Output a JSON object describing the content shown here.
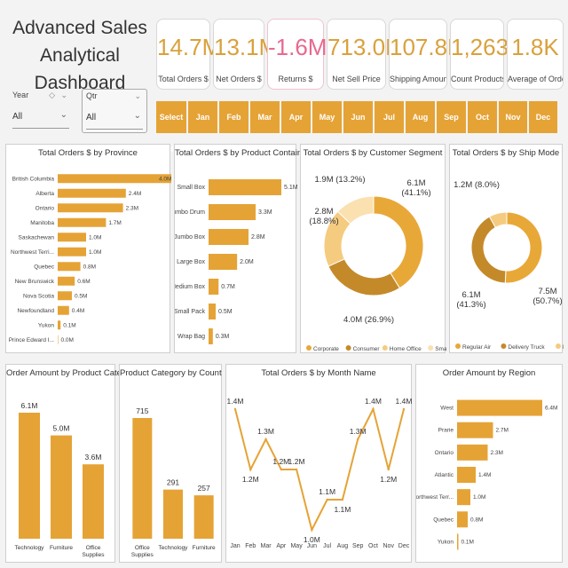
{
  "title_line1": "Advanced Sales",
  "title_line2": "Analytical Dashboard",
  "kpis": [
    {
      "value": "14.7M",
      "label": "Total Orders $"
    },
    {
      "value": "13.1M",
      "label": "Net Orders $"
    },
    {
      "value": "-1.6M",
      "label": "Returns $"
    },
    {
      "value": "713.0K",
      "label": "Net Sell Price"
    },
    {
      "value": "107.8K",
      "label": "Shipping Amount"
    },
    {
      "value": "1,263",
      "label": "Count Products"
    },
    {
      "value": "1.8K",
      "label": "Average of Order ..."
    }
  ],
  "slicers": {
    "year": {
      "title": "Year",
      "value": "All"
    },
    "qtr": {
      "title": "Qtr",
      "value": "All"
    }
  },
  "months": [
    "Select all",
    "Jan",
    "Feb",
    "Mar",
    "Apr",
    "May",
    "Jun",
    "Jul",
    "Aug",
    "Sep",
    "Oct",
    "Nov",
    "Dec"
  ],
  "colors": {
    "accent": "#e5a336",
    "negative": "#e8698f"
  },
  "chart_data": [
    {
      "id": "province",
      "type": "bar",
      "orientation": "horizontal",
      "title": "Total Orders $ by Province",
      "categories": [
        "British Columbia",
        "Alberta",
        "Ontario",
        "Manitoba",
        "Saskachewan",
        "Northwest Terri...",
        "Quebec",
        "New Brunswick",
        "Nova Scotia",
        "Newfoundland",
        "Yukon",
        "Prince Edward I..."
      ],
      "values": [
        4.0,
        2.4,
        2.3,
        1.7,
        1.0,
        1.0,
        0.8,
        0.6,
        0.5,
        0.4,
        0.1,
        0.0
      ],
      "labels": [
        "4.0M",
        "2.4M",
        "2.3M",
        "1.7M",
        "1.0M",
        "1.0M",
        "0.8M",
        "0.6M",
        "0.5M",
        "0.4M",
        "0.1M",
        "0.0M"
      ]
    },
    {
      "id": "container",
      "type": "bar",
      "orientation": "horizontal",
      "title": "Total Orders $ by Product Container",
      "categories": [
        "Small Box",
        "Jumbo Drum",
        "Jumbo Box",
        "Large Box",
        "Medium Box",
        "Small Pack",
        "Wrap Bag"
      ],
      "values": [
        5.1,
        3.3,
        2.8,
        2.0,
        0.7,
        0.5,
        0.3
      ],
      "labels": [
        "5.1M",
        "3.3M",
        "2.8M",
        "2.0M",
        "0.7M",
        "0.5M",
        "0.3M"
      ]
    },
    {
      "id": "segment",
      "type": "pie",
      "donut": true,
      "title": "Total Orders $ by Customer Segment",
      "categories": [
        "Corporate",
        "Consumer",
        "Home Office",
        "Small Business"
      ],
      "values": [
        6.1,
        4.0,
        2.8,
        1.9
      ],
      "labels": [
        "6.1M\n(41.1%)",
        "4.0M (26.9%)",
        "2.8M\n(18.8%)",
        "1.9M (13.2%)"
      ],
      "colors": [
        "#e8a838",
        "#c48a2a",
        "#f5cb80",
        "#fbe0b0"
      ],
      "legend": "bottom"
    },
    {
      "id": "shipmode",
      "type": "pie",
      "donut": true,
      "title": "Total Orders $ by Ship Mode",
      "categories": [
        "Regular Air",
        "Delivery Truck",
        "Express Air"
      ],
      "values": [
        7.5,
        6.1,
        1.2
      ],
      "labels": [
        "7.5M\n(50.7%)",
        "6.1M\n(41.3%)",
        "1.2M (8.0%)"
      ],
      "colors": [
        "#e8a838",
        "#c48a2a",
        "#f5cb80"
      ],
      "legend": "bottom"
    },
    {
      "id": "category",
      "type": "bar",
      "orientation": "vertical",
      "title": "Order Amount by Product Category",
      "categories": [
        "Technology",
        "Furniture",
        "Office\nSupplies"
      ],
      "values": [
        6.1,
        5.0,
        3.6
      ],
      "labels": [
        "6.1M",
        "5.0M",
        "3.6M"
      ]
    },
    {
      "id": "catcount",
      "type": "bar",
      "orientation": "vertical",
      "title": "Product Category by Count",
      "categories": [
        "Office\nSupplies",
        "Technology",
        "Furniture"
      ],
      "values": [
        715,
        291,
        257
      ],
      "labels": [
        "715",
        "291",
        "257"
      ]
    },
    {
      "id": "month",
      "type": "line",
      "title": "Total Orders $ by Month Name",
      "categories": [
        "Jan",
        "Feb",
        "Mar",
        "Apr",
        "May",
        "Jun",
        "Jul",
        "Aug",
        "Sep",
        "Oct",
        "Nov",
        "Dec"
      ],
      "values": [
        1.4,
        1.2,
        1.3,
        1.2,
        1.2,
        1.0,
        1.1,
        1.1,
        1.3,
        1.4,
        1.2,
        1.4
      ],
      "labels": [
        "1.4M",
        "1.2M",
        "1.3M",
        "1.2M",
        "1.2M",
        "1.0M",
        "1.1M",
        "1.1M",
        "1.3M",
        "1.4M",
        "1.2M",
        "1.4M"
      ]
    },
    {
      "id": "region",
      "type": "bar",
      "orientation": "horizontal",
      "title": "Order Amount by Region",
      "categories": [
        "West",
        "Prarie",
        "Ontario",
        "Atlantic",
        "Northwest Terr...",
        "Quebec",
        "Yukon"
      ],
      "values": [
        6.4,
        2.7,
        2.3,
        1.4,
        1.0,
        0.8,
        0.1
      ],
      "labels": [
        "6.4M",
        "2.7M",
        "2.3M",
        "1.4M",
        "1.0M",
        "0.8M",
        "0.1M"
      ]
    }
  ]
}
